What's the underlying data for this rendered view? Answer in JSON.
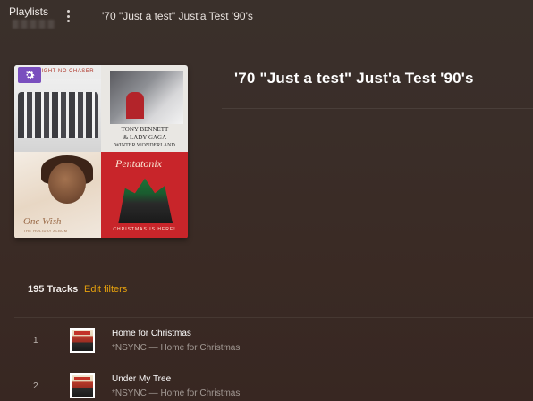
{
  "topbar": {
    "section_label": "Playlists",
    "current_title": "'70 \"Just a test\" Just'a Test '90's",
    "more_icon": "vertical-ellipsis-icon"
  },
  "playlist": {
    "title": "'70 \"Just a test\" Just'a Test '90's",
    "poster_badge_icon": "gear-icon",
    "poster_covers": [
      {
        "text_lines": [
          "...IGHT NO CHASER"
        ]
      },
      {
        "text_lines": [
          "TONY BENNETT",
          "& LADY GAGA",
          "WINTER WONDERLAND"
        ]
      },
      {
        "text_lines": [
          "One Wish",
          "THE HOLIDAY ALBUM"
        ]
      },
      {
        "text_lines": [
          "Pentatonix",
          "CHRISTMAS IS HERE!"
        ]
      }
    ]
  },
  "summary": {
    "track_count": "195 Tracks",
    "edit_filters_label": "Edit filters"
  },
  "tracks": [
    {
      "number": "1",
      "title": "Home for Christmas",
      "artist_album": "*NSYNC — Home for Christmas"
    },
    {
      "number": "2",
      "title": "Under My Tree",
      "artist_album": "*NSYNC — Home for Christmas"
    }
  ],
  "colors": {
    "accent": "#e5a00d",
    "badge": "#7a4fbe",
    "background": "#3a2e29"
  }
}
